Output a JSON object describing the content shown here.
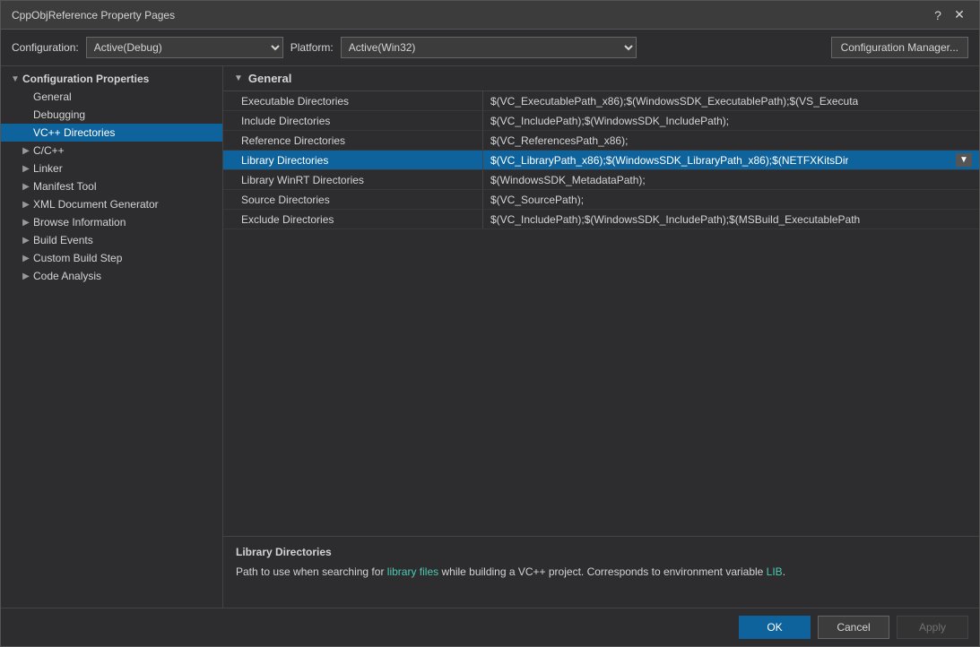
{
  "dialog": {
    "title": "CppObjReference Property Pages",
    "help_btn": "?",
    "close_btn": "✕"
  },
  "toolbar": {
    "config_label": "Configuration:",
    "platform_label": "Platform:",
    "config_value": "Active(Debug)",
    "platform_value": "Active(Win32)",
    "config_mgr_label": "Configuration Manager..."
  },
  "left_tree": {
    "root_label": "Configuration Properties",
    "items": [
      {
        "label": "General",
        "indent": 1,
        "expandable": false,
        "id": "general"
      },
      {
        "label": "Debugging",
        "indent": 1,
        "expandable": false,
        "id": "debugging"
      },
      {
        "label": "VC++ Directories",
        "indent": 1,
        "expandable": false,
        "id": "vcpp-dirs",
        "selected": true
      },
      {
        "label": "C/C++",
        "indent": 1,
        "expandable": true,
        "id": "cpp"
      },
      {
        "label": "Linker",
        "indent": 1,
        "expandable": true,
        "id": "linker"
      },
      {
        "label": "Manifest Tool",
        "indent": 1,
        "expandable": true,
        "id": "manifest-tool"
      },
      {
        "label": "XML Document Generator",
        "indent": 1,
        "expandable": true,
        "id": "xml-doc-gen"
      },
      {
        "label": "Browse Information",
        "indent": 1,
        "expandable": true,
        "id": "browse-info"
      },
      {
        "label": "Build Events",
        "indent": 1,
        "expandable": true,
        "id": "build-events"
      },
      {
        "label": "Custom Build Step",
        "indent": 1,
        "expandable": true,
        "id": "custom-build-step"
      },
      {
        "label": "Code Analysis",
        "indent": 1,
        "expandable": true,
        "id": "code-analysis"
      }
    ]
  },
  "props": {
    "section_label": "General",
    "expand_icon": "▼",
    "rows": [
      {
        "id": "executable-dirs",
        "name": "Executable Directories",
        "value": "$(VC_ExecutablePath_x86);$(WindowsSDK_ExecutablePath);$(VS_Executa",
        "selected": false,
        "has_dropdown": false
      },
      {
        "id": "include-dirs",
        "name": "Include Directories",
        "value": "$(VC_IncludePath);$(WindowsSDK_IncludePath);",
        "selected": false,
        "has_dropdown": false
      },
      {
        "id": "reference-dirs",
        "name": "Reference Directories",
        "value": "$(VC_ReferencesPath_x86);",
        "selected": false,
        "has_dropdown": false
      },
      {
        "id": "library-dirs",
        "name": "Library Directories",
        "value": "$(VC_LibraryPath_x86);$(WindowsSDK_LibraryPath_x86);$(NETFXKitsDir",
        "selected": true,
        "has_dropdown": true
      },
      {
        "id": "library-winrt-dirs",
        "name": "Library WinRT Directories",
        "value": "$(WindowsSDK_MetadataPath);",
        "selected": false,
        "has_dropdown": false
      },
      {
        "id": "source-dirs",
        "name": "Source Directories",
        "value": "$(VC_SourcePath);",
        "selected": false,
        "has_dropdown": false
      },
      {
        "id": "exclude-dirs",
        "name": "Exclude Directories",
        "value": "$(VC_IncludePath);$(WindowsSDK_IncludePath);$(MSBuild_ExecutablePath",
        "selected": false,
        "has_dropdown": false
      }
    ]
  },
  "info": {
    "title": "Library Directories",
    "description_parts": [
      {
        "text": "Path to use when searching for "
      },
      {
        "text": "library files",
        "highlight": true
      },
      {
        "text": " while building a VC++ project.  Corresponds to environment variable "
      },
      {
        "text": "LIB",
        "highlight": true
      },
      {
        "text": "."
      }
    ]
  },
  "footer": {
    "ok_label": "OK",
    "cancel_label": "Cancel",
    "apply_label": "Apply"
  }
}
